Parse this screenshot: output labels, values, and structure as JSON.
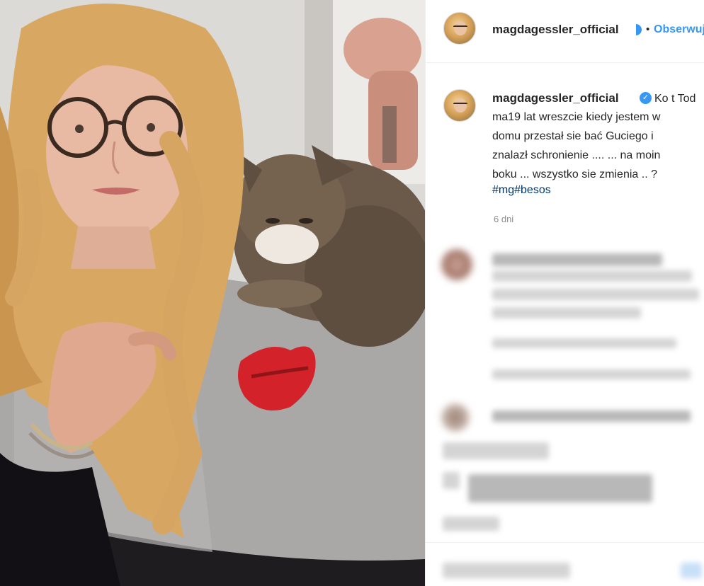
{
  "post": {
    "username": "magdagessler_official",
    "follow_label": "Obserwuj",
    "bullet": "•",
    "verified_mark": "✓"
  },
  "caption": {
    "username": "magdagessler_official",
    "lines": [
      "Ko t Tod",
      "ma19 lat wreszcie kiedy jestem w",
      "domu przestał sie bać Guciego i",
      "znalazł schronienie .... ... na moin",
      "boku ... wszystko sie zmienia .. ?"
    ],
    "hashtags": "#mg#besos",
    "time_ago": "6 dni"
  },
  "colors": {
    "link_blue": "#3897f0",
    "hashtag_blue": "#00376b",
    "text": "#262626",
    "muted": "#8e8e8e",
    "lipstick_red": "#d4222b"
  },
  "icons": {
    "verified": "verified-badge-icon"
  }
}
